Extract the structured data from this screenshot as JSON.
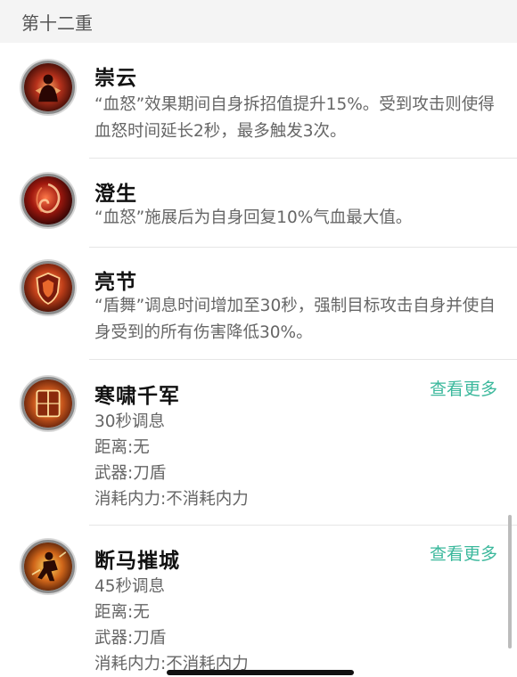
{
  "section": {
    "title": "第十二重"
  },
  "skills": [
    {
      "name": "崇云",
      "description": "“血怒”效果期间自身拆招值提升15%。受到攻击则使得血怒时间延长2秒，最多触发3次。",
      "icon": "crimson-figure-icon"
    },
    {
      "name": "澄生",
      "description": "“血怒”施展后为自身回复10%气血最大值。",
      "icon": "crimson-swirl-icon"
    },
    {
      "name": "亮节",
      "description": "“盾舞”调息时间增加至30秒，强制目标攻击自身并使自身受到的所有伤害降低30%。",
      "icon": "shield-emblem-icon"
    },
    {
      "name": "寒啸千军",
      "more": "查看更多",
      "cooldown": "30秒调息",
      "range": "距离:无",
      "weapon": "武器:刀盾",
      "cost": "消耗内力:不消耗内力",
      "icon": "golden-shield-icon"
    },
    {
      "name": "断马摧城",
      "more": "查看更多",
      "cooldown": "45秒调息",
      "range": "距离:无",
      "weapon": "武器:刀盾",
      "cost": "消耗内力:不消耗内力",
      "icon": "charging-warrior-icon"
    }
  ],
  "colors": {
    "accent": "#3bb89c",
    "header_bg": "#f4f4f4",
    "text_secondary": "#666666"
  }
}
